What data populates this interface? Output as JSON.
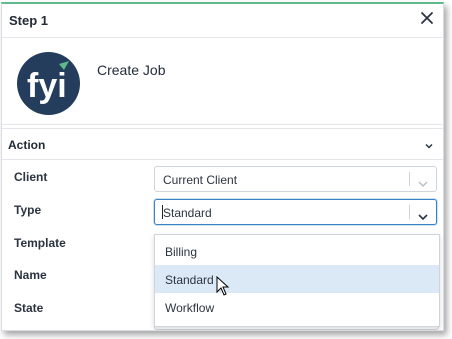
{
  "header": {
    "title": "Step 1"
  },
  "job": {
    "name": "Create Job",
    "logo_text": "fyi"
  },
  "section": {
    "label": "Action"
  },
  "fields": [
    {
      "label": "Client",
      "value": "Current Client"
    },
    {
      "label": "Type",
      "value": "Standard"
    },
    {
      "label": "Template"
    },
    {
      "label": "Name"
    },
    {
      "label": "State"
    }
  ],
  "dropdown": {
    "options": [
      "Billing",
      "Standard",
      "Workflow"
    ],
    "highlighted": "Standard"
  },
  "colors": {
    "accent_top": "#5fb98a",
    "logo_bg": "#243d5c",
    "logo_leaf": "#5fb98a",
    "focus": "#3b82c4",
    "highlight": "#dbe8f5"
  }
}
